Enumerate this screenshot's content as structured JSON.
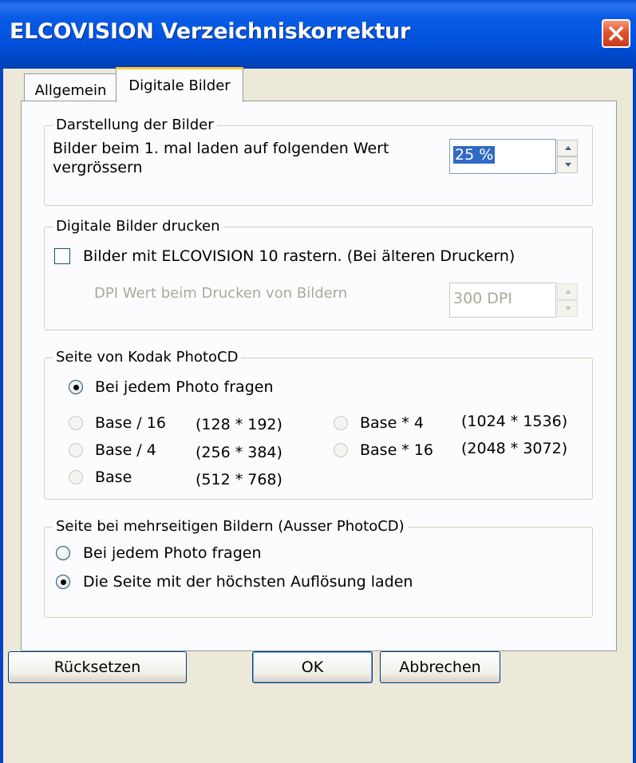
{
  "window": {
    "title": "ELCOVISION Verzeichniskorrektur"
  },
  "tabs": [
    {
      "label": "Allgemein",
      "active": false
    },
    {
      "label": "Digitale Bilder",
      "active": true
    }
  ],
  "display_group": {
    "title": "Darstellung der Bilder",
    "text_line1": "Bilder beim 1. mal laden auf folgenden Wert",
    "text_line2": "vergrössern",
    "zoom_value": "25 %"
  },
  "print_group": {
    "title": "Digitale Bilder drucken",
    "raster_checkbox_label": "Bilder mit ELCOVISION 10 rastern. (Bei älteren Druckern)",
    "raster_checked": false,
    "dpi_label": "DPI Wert beim Drucken von Bildern",
    "dpi_value": "300 DPI"
  },
  "photocd_group": {
    "title": "Seite von Kodak PhotoCD",
    "options": [
      {
        "label": "Bei jedem Photo fragen",
        "size": "",
        "selected": true,
        "enabled": true
      },
      {
        "label": "Base / 16",
        "size": "(128 * 192)",
        "selected": false,
        "enabled": false
      },
      {
        "label": "Base / 4",
        "size": "(256 * 384)",
        "selected": false,
        "enabled": false
      },
      {
        "label": "Base",
        "size": "(512 * 768)",
        "selected": false,
        "enabled": false
      },
      {
        "label": "Base * 4",
        "size": "(1024 * 1536)",
        "selected": false,
        "enabled": false
      },
      {
        "label": "Base * 16",
        "size": "(2048 * 3072)",
        "selected": false,
        "enabled": false
      }
    ]
  },
  "multipage_group": {
    "title": "Seite bei mehrseitigen Bildern (Ausser PhotoCD)",
    "options": [
      {
        "label": "Bei jedem Photo fragen",
        "selected": false
      },
      {
        "label": "Die Seite mit der höchsten Auflösung laden",
        "selected": true
      }
    ]
  },
  "buttons": {
    "reset": "Rücksetzen",
    "ok": "OK",
    "cancel": "Abbrechen"
  },
  "colors": {
    "titlebar": "#0052dd",
    "close_button": "#e0532f",
    "tab_highlight": "#ffc83c",
    "dialog_bg": "#ece9d8"
  }
}
